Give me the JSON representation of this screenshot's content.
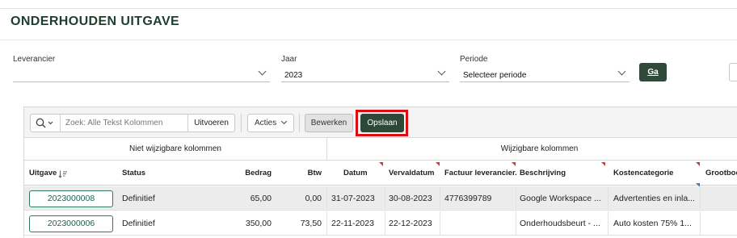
{
  "page": {
    "title": "ONDERHOUDEN UITGAVE"
  },
  "filters": {
    "leverancier": {
      "label": "Leverancier",
      "value": ""
    },
    "jaar": {
      "label": "Jaar",
      "value": "2023"
    },
    "periode": {
      "label": "Periode",
      "value": "Selecteer periode"
    },
    "go_label": "Ga"
  },
  "toolbar": {
    "search_placeholder": "Zoek: Alle Tekst Kolommen",
    "run_label": "Uitvoeren",
    "actions_label": "Acties",
    "edit_label": "Bewerken",
    "save_label": "Opslaan"
  },
  "groups": {
    "readonly": "Niet wijzigbare kolommen",
    "editable": "Wijzigbare kolommen"
  },
  "columns": {
    "uitgave": "Uitgave",
    "status": "Status",
    "bedrag": "Bedrag",
    "btw": "Btw",
    "datum": "Datum",
    "vervaldatum": "Vervaldatum",
    "factuur": "Factuur leverancier..",
    "beschrijving": "Beschrijving",
    "kostencategorie": "Kostencategorie",
    "grootboek": "Grootboe"
  },
  "rows": [
    {
      "uitgave": "2023000008",
      "status": "Definitief",
      "bedrag": "65,00",
      "btw": "0,00",
      "datum": "31-07-2023",
      "vervaldatum": "30-08-2023",
      "factuur": "4776399789",
      "beschrijving": "Google Workspace ...",
      "kostencategorie": "Advertenties en inla..."
    },
    {
      "uitgave": "2023000006",
      "status": "Definitief",
      "bedrag": "350,00",
      "btw": "73,50",
      "datum": "22-11-2023",
      "vervaldatum": "22-12-2023",
      "factuur": "",
      "beschrijving": "Onderhoudsbeurt - ...",
      "kostencategorie": "Auto kosten 75% 1..."
    }
  ],
  "colors": {
    "primary": "#2c4937",
    "highlight": "#d90d12",
    "link": "#1d5f52"
  }
}
